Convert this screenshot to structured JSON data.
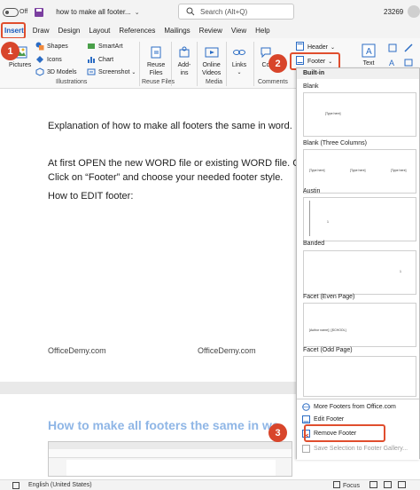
{
  "titlebar": {
    "autosave_state": "Off",
    "doc_title": "how to make all footer...",
    "search_placeholder": "Search (Alt+Q)",
    "user_id": "23269"
  },
  "tabs": [
    "Insert",
    "Draw",
    "Design",
    "Layout",
    "References",
    "Mailings",
    "Review",
    "View",
    "Help"
  ],
  "ribbon": {
    "pictures": "Pictures",
    "shapes": "Shapes",
    "icons": "Icons",
    "models": "3D Models",
    "smartart": "SmartArt",
    "chart": "Chart",
    "screenshot": "Screenshot",
    "illustrations_group": "Illustrations",
    "reuse_line1": "Reuse",
    "reuse_line2": "Files",
    "reuse_group": "Reuse Files",
    "addins_line1": "Add-",
    "addins_line2": "ins",
    "online_line1": "Online",
    "online_line2": "Videos",
    "media_group": "Media",
    "links_line1": "Links",
    "comments_partial": "Co",
    "comments_group": "Comments",
    "header": "Header",
    "footer": "Footer",
    "text": "Text"
  },
  "callouts": [
    "1",
    "2",
    "3"
  ],
  "document": {
    "line1": "Explanation of how to make all footers the same in word.",
    "line2": "At first OPEN the new WORD file or existing WORD file. C",
    "line3": "Click on “Footer” and choose your needed footer style.",
    "line4": "How to EDIT footer:",
    "watermark": "OfficeDemy.com",
    "heading": "How to make all footers the same in wo"
  },
  "gallery": {
    "section": "Built-in",
    "items": [
      {
        "name": "Blank",
        "sample": "[Type here]"
      },
      {
        "name": "Blank (Three Columns)",
        "sample": "[Type here]"
      },
      {
        "name": "Austin",
        "sample": "1"
      },
      {
        "name": "Banded",
        "sample": ""
      },
      {
        "name": "Facet (Even Page)",
        "sample": "[Author name] | [SCHOOL]"
      },
      {
        "name": "Facet (Odd Page)",
        "sample": ""
      }
    ],
    "commands": {
      "more": "More Footers from Office.com",
      "edit": "Edit Footer",
      "remove": "Remove Footer",
      "save": "Save Selection to Footer Gallery..."
    }
  },
  "statusbar": {
    "language": "English (United States)",
    "focus": "Focus"
  },
  "colors": {
    "accent_blue": "#185abd",
    "callout_red": "#d8452b",
    "heading_blue": "#8fb6e6"
  }
}
